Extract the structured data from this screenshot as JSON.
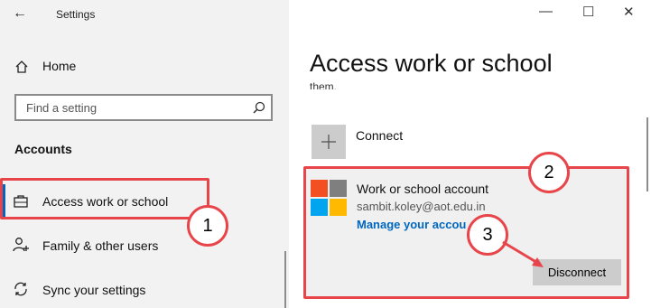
{
  "header": {
    "back_icon": "arrow-left-icon",
    "app_title": "Settings"
  },
  "sidebar": {
    "home_label": "Home",
    "search_placeholder": "Find a setting",
    "section_title": "Accounts",
    "items": [
      {
        "label": "Access work or school",
        "icon": "briefcase-icon",
        "active": true
      },
      {
        "label": "Family & other users",
        "icon": "person-add-icon"
      },
      {
        "label": "Sync your settings",
        "icon": "sync-icon"
      }
    ]
  },
  "window_controls": {
    "minimize": "—",
    "maximize": "☐",
    "close": "✕"
  },
  "main": {
    "title": "Access work or school",
    "cut_text": "them.",
    "connect_label": "Connect",
    "account": {
      "title": "Work or school account",
      "email": "sambit.koley@aot.edu.in",
      "manage_link": "Manage your accou",
      "disconnect_label": "Disconnect"
    }
  },
  "annotations": {
    "badge_1": "1",
    "badge_2": "2",
    "badge_3": "3"
  },
  "colors": {
    "highlight": "#e8454a",
    "accent": "#0067c0",
    "ms_red": "#f25022",
    "ms_green": "#7f7f7f",
    "ms_blue": "#00a4ef",
    "ms_yellow": "#ffb900"
  }
}
